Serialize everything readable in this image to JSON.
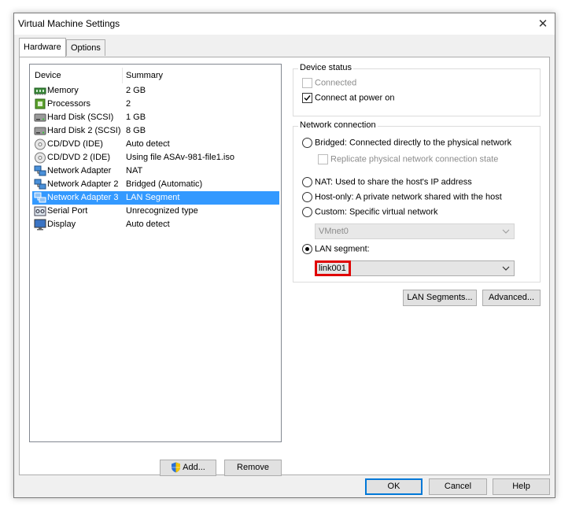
{
  "window": {
    "title": "Virtual Machine Settings",
    "close_glyph": "✕"
  },
  "tabs": [
    {
      "label": "Hardware",
      "active": true
    },
    {
      "label": "Options",
      "active": false
    }
  ],
  "device_list": {
    "headers": {
      "device": "Device",
      "summary": "Summary"
    },
    "rows": [
      {
        "device": "Memory",
        "summary": "2 GB",
        "icon": "memory-icon"
      },
      {
        "device": "Processors",
        "summary": "2",
        "icon": "processor-icon"
      },
      {
        "device": "Hard Disk (SCSI)",
        "summary": "1 GB",
        "icon": "hard-disk-icon"
      },
      {
        "device": "Hard Disk 2 (SCSI)",
        "summary": "8 GB",
        "icon": "hard-disk-icon"
      },
      {
        "device": "CD/DVD (IDE)",
        "summary": "Auto detect",
        "icon": "cd-dvd-icon"
      },
      {
        "device": "CD/DVD 2 (IDE)",
        "summary": "Using file ASAv-981-file1.iso",
        "icon": "cd-dvd-icon"
      },
      {
        "device": "Network Adapter",
        "summary": "NAT",
        "icon": "network-adapter-icon"
      },
      {
        "device": "Network Adapter 2",
        "summary": "Bridged (Automatic)",
        "icon": "network-adapter-icon"
      },
      {
        "device": "Network Adapter 3",
        "summary": "LAN Segment",
        "icon": "network-adapter-icon",
        "selected": true
      },
      {
        "device": "Serial Port",
        "summary": "Unrecognized type",
        "icon": "serial-port-icon"
      },
      {
        "device": "Display",
        "summary": "Auto detect",
        "icon": "display-icon"
      }
    ]
  },
  "list_buttons": {
    "add": "Add...",
    "remove": "Remove"
  },
  "device_status": {
    "title": "Device status",
    "connected": {
      "label": "Connected",
      "checked": false,
      "enabled": false
    },
    "connect_at_power_on": {
      "label": "Connect at power on",
      "checked": true,
      "enabled": true
    }
  },
  "network_connection": {
    "title": "Network connection",
    "bridged": "Bridged: Connected directly to the physical network",
    "replicate": "Replicate physical network connection state",
    "nat": "NAT: Used to share the host's IP address",
    "host_only": "Host-only: A private network shared with the host",
    "custom": "Custom: Specific virtual network",
    "vmnet_value": "VMnet0",
    "lan_segment": "LAN segment:",
    "lan_segment_value": "link001",
    "selected_option": "lan_segment"
  },
  "network_buttons": {
    "lan_segments": "LAN Segments...",
    "advanced": "Advanced..."
  },
  "footer": {
    "ok": "OK",
    "cancel": "Cancel",
    "help": "Help"
  },
  "colors": {
    "selection": "#3399ff",
    "default_button_border": "#0078d7",
    "highlight": "#e00000"
  }
}
